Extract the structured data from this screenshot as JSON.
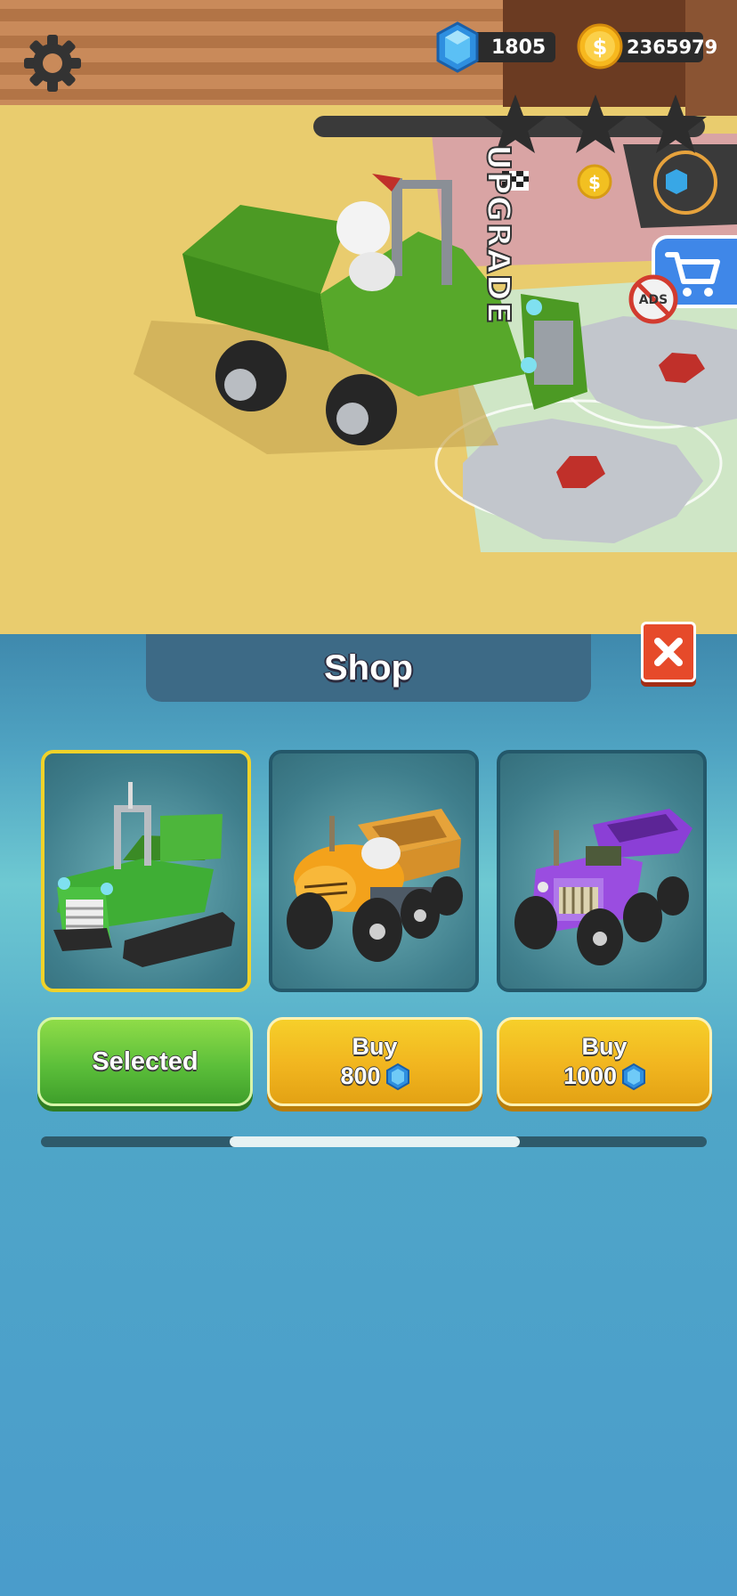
{
  "hud": {
    "gems": "1805",
    "coins": "2365979",
    "stars_earned": 0,
    "stars_total": 3
  },
  "scene": {
    "upgrade_label": "UPGRADE",
    "noads_label": "ADS"
  },
  "shop": {
    "title": "Shop",
    "items": [
      {
        "vehicle": "green tracked dump truck",
        "state": "Selected",
        "color": "#3fb33a"
      },
      {
        "vehicle": "orange tractor",
        "action": "Buy",
        "price": "800",
        "color": "#f3a21b"
      },
      {
        "vehicle": "purple truck",
        "action": "Buy",
        "price": "1000",
        "color": "#8b3fd6"
      }
    ]
  },
  "colors": {
    "selected_border": "#f0d22a",
    "selected_button": "#5cbf3a",
    "buy_button": "#f1b51f",
    "close_button": "#e64a2a",
    "cart_button": "#3f87e8"
  }
}
